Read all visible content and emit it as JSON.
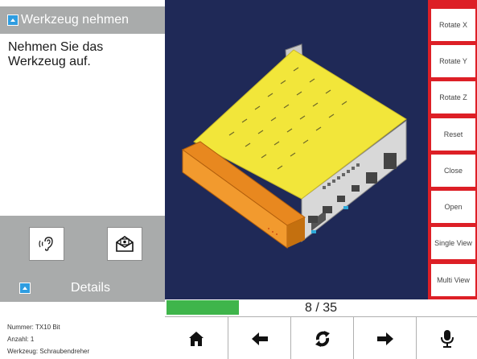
{
  "step": {
    "title": "Werkzeug nehmen",
    "instruction": "Nehmen Sie das Werkzeug auf."
  },
  "media": {
    "audio_icon": "ear-sound-icon",
    "mail_icon": "mail-icon"
  },
  "details": {
    "title": "Details",
    "rows": [
      "Nummer: TX10 Bit",
      "Anzahl: 1",
      "Werkzeug: Schraubendreher"
    ]
  },
  "viewer": {
    "background": "#1f2957",
    "model_color": "#f2e63a"
  },
  "tools": [
    "Rotate X",
    "Rotate Y",
    "Rotate Z",
    "Reset",
    "Close",
    "Open",
    "Single View",
    "Multi View"
  ],
  "progress": {
    "label": "8 / 35",
    "current": 8,
    "total": 35
  },
  "nav": {
    "icons": [
      "home-icon",
      "arrow-left-icon",
      "refresh-icon",
      "arrow-right-icon",
      "microphone-icon"
    ]
  },
  "colors": {
    "accent": "#dd1f26",
    "progress": "#3fb54b",
    "panel": "#a9abab"
  }
}
